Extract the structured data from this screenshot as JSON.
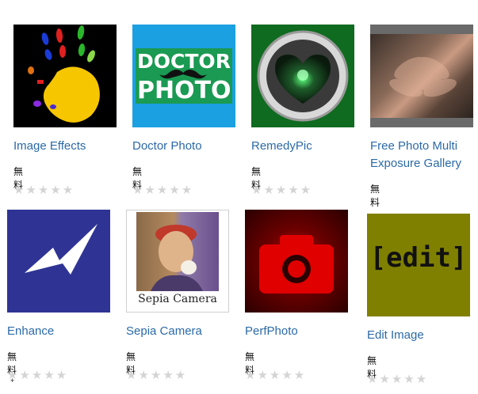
{
  "apps": [
    {
      "name": "Image Effects",
      "price": "無料",
      "stars": "★★★★★"
    },
    {
      "name": "Doctor Photo",
      "price": "無料",
      "stars": "★★★★★",
      "logo_lines": [
        "DOCTOR",
        "PHOTO"
      ]
    },
    {
      "name": "RemedyPic",
      "price": "無料",
      "stars": "★★★★★"
    },
    {
      "name": "Free Photo Multi Exposure Gallery",
      "price": "無料"
    },
    {
      "name": "Enhance",
      "price": "無料",
      "plus": "+",
      "stars": "★★★★★"
    },
    {
      "name": "Sepia Camera",
      "price": "無料",
      "stars": "★★★★★",
      "caption": "Sepia Camera"
    },
    {
      "name": "PerfPhoto",
      "price": "無料",
      "stars": "★★★★★"
    },
    {
      "name": "Edit Image",
      "price": "無料",
      "stars": "★★★★★",
      "logo_text": "[edit]"
    }
  ],
  "colors": {
    "link": "#2b6aa6",
    "doctor_bg": "#1ba0e1",
    "doctor_band": "#1a9a52",
    "remedy_bg": "#0f6b1f",
    "enhance_bg": "#2f3494",
    "perf_bg": "#7a0000",
    "perf_camera": "#e00000",
    "edit_bg": "#808000",
    "star_empty": "#d4d4d4"
  }
}
